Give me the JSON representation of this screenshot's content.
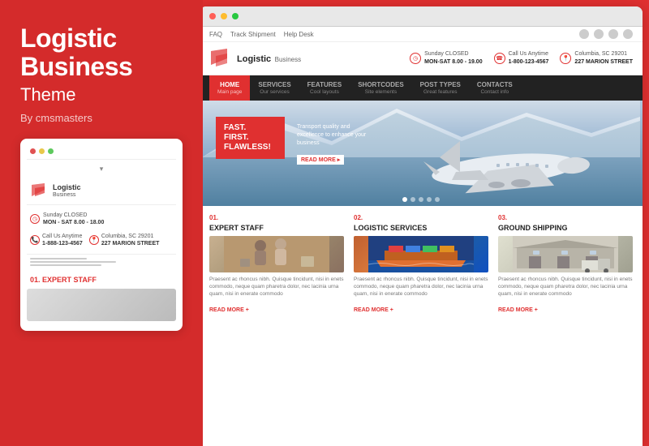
{
  "left": {
    "title_line1": "Logistic",
    "title_line2": "Business",
    "subtitle": "Theme",
    "by": "By cmsmasters"
  },
  "mobile": {
    "dots": [
      "red",
      "yellow",
      "green"
    ],
    "dropdown": "▾",
    "logo_main": "Logistic",
    "logo_sub": "Business",
    "hours_label": "Sunday CLOSED",
    "hours_value": "MON - SAT 8.00 - 18.00",
    "call_label": "Call Us Anytime",
    "call_value": "1-888-123-4567",
    "address_label": "Columbia, SC 29201",
    "address_value": "227 MARION STREET",
    "section_num": "01.",
    "section_title": "EXPERT STAFF"
  },
  "browser": {
    "topbar": {
      "links": [
        "FAQ",
        "Track Shipment",
        "Help Desk"
      ],
      "social_icons": [
        "in",
        "f",
        "t",
        "g+"
      ]
    },
    "header": {
      "logo_main": "Logistic",
      "logo_sub": "Business",
      "info1_top": "Sunday CLOSED",
      "info1_bottom": "MON-SAT 8.00 - 19.00",
      "info2_top": "Call Us Anytime",
      "info2_bottom": "1-800-123-4567",
      "info3_top": "Columbia, SC 29201",
      "info3_bottom": "227 MARION STREET"
    },
    "nav": [
      {
        "label": "HOME",
        "sub": "Main page",
        "active": true
      },
      {
        "label": "SERVICES",
        "sub": "Our services",
        "active": false
      },
      {
        "label": "FEATURES",
        "sub": "Cool layouts",
        "active": false
      },
      {
        "label": "SHORTCODES",
        "sub": "Site elements",
        "active": false
      },
      {
        "label": "POST TYPES",
        "sub": "Great features",
        "active": false
      },
      {
        "label": "CONTACTS",
        "sub": "Contact info",
        "active": false
      }
    ],
    "hero": {
      "line1": "FAST.",
      "line2": "FIRST.",
      "line3": "FLAWLESS!",
      "side_text": "Transport quality and excellence to enhance your business",
      "read_more": "READ MORE ▸",
      "dots": [
        true,
        false,
        false,
        false,
        false
      ]
    },
    "features": [
      {
        "num": "01.",
        "title": "EXPERT STAFF",
        "text": "Praesent ac rhoncus nibh. Quisque tincidunt, nisi in enets commodo, neque quam pharetra dolor, nec lacinia urna quam, nisi in enerate commodo",
        "read_more": "READ MORE +"
      },
      {
        "num": "02.",
        "title": "LOGISTIC SERVICES",
        "text": "Praesent ac rhoncus nibh. Quisque tincidunt, nisi in enets commodo, neque quam pharetra dolor, nec lacinia urna quam, nisi in enerate commodo",
        "read_more": "READ MORE +"
      },
      {
        "num": "03.",
        "title": "GROUND SHIPPING",
        "text": "Praesent ac rhoncus nibh. Quisque tincidunt, nisi in enets commodo, neque quam pharetra dolor, nec lacinia urna quam, nisi in enerate commodo",
        "read_more": "READ MORE +"
      }
    ]
  },
  "colors": {
    "accent": "#e03030",
    "dark": "#222222",
    "light": "#ffffff"
  }
}
